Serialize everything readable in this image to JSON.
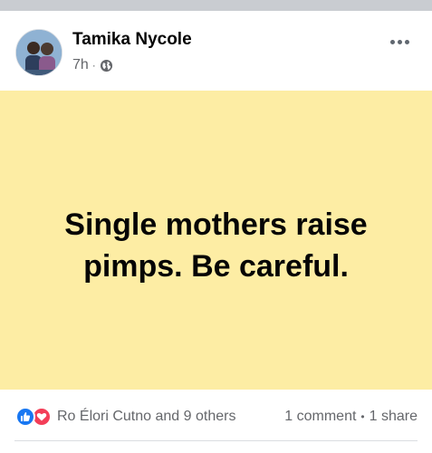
{
  "post": {
    "author": "Tamika Nycole",
    "time": "7h",
    "separator": "·",
    "privacy_icon": "globe-icon",
    "more_icon": "more-options-icon",
    "text": "Single mothers raise pimps. Be careful.",
    "background_color": "#fdeda4"
  },
  "footer": {
    "reaction_icons": [
      "like-icon",
      "love-icon"
    ],
    "reactions_label": "Ro Élori Cutno and 9 others",
    "comments": "1 comment",
    "separator": "•",
    "shares": "1 share"
  },
  "colors": {
    "like": "#1877f2",
    "love": "#f33e58",
    "secondary_text": "#65676b"
  }
}
